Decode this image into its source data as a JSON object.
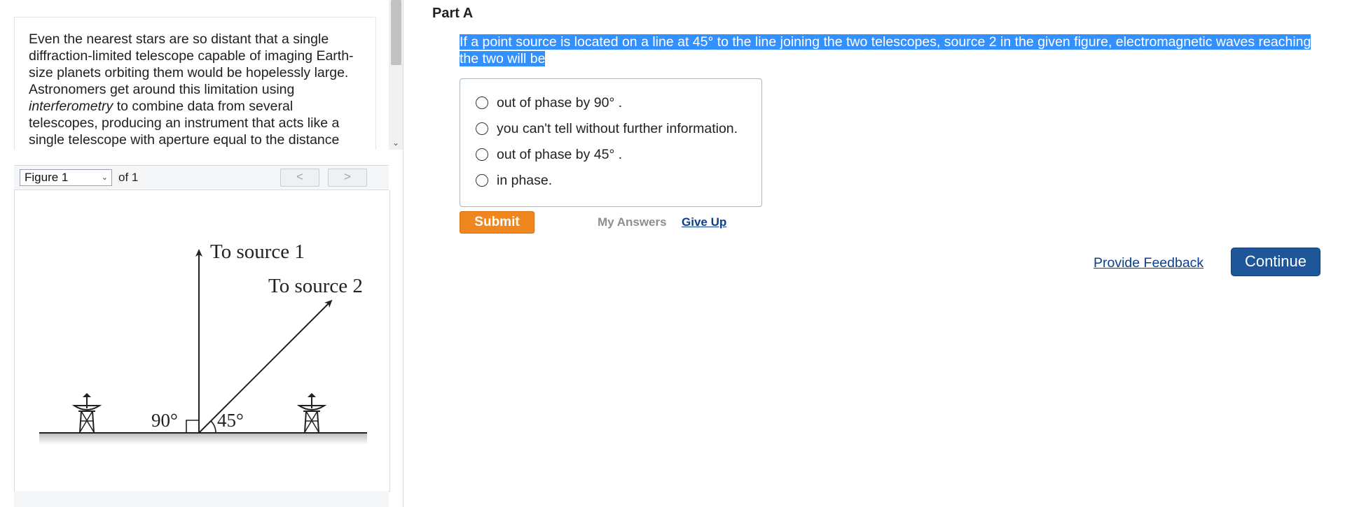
{
  "passage": {
    "text_before": "Even the nearest stars are so distant that a single diffraction-limited telescope capable of imaging Earth-size planets orbiting them would be hopelessly large. Astronomers get around this limitation using ",
    "text_emphasis": "interferometry",
    "text_after": " to combine data from several telescopes, producing an instrument that acts like a single telescope with aperture equal to the distance"
  },
  "figure_nav": {
    "selected": "Figure 1",
    "of_label": "of 1",
    "prev_glyph": "<",
    "next_glyph": ">"
  },
  "figure": {
    "source1_label": "To source 1",
    "source2_label": "To source 2",
    "angle_left": "90°",
    "angle_right": "45°"
  },
  "part": {
    "title": "Part A"
  },
  "question": {
    "text": "If a point source is located on a line at 45° to the line joining the two telescopes, source 2 in the given figure, electromagnetic waves reaching the two will be"
  },
  "options": [
    {
      "label": "out of phase by 90° ."
    },
    {
      "label": "you can't tell without further information."
    },
    {
      "label": "out of phase by 45° ."
    },
    {
      "label": "in phase."
    }
  ],
  "actions": {
    "submit": "Submit",
    "my_answers": "My Answers",
    "give_up": "Give Up",
    "provide_feedback": "Provide Feedback",
    "continue": "Continue"
  },
  "colors": {
    "selection_highlight": "#3390ff",
    "submit_orange": "#f0871e",
    "continue_blue": "#1d5799",
    "link_blue": "#0b3f8c"
  }
}
